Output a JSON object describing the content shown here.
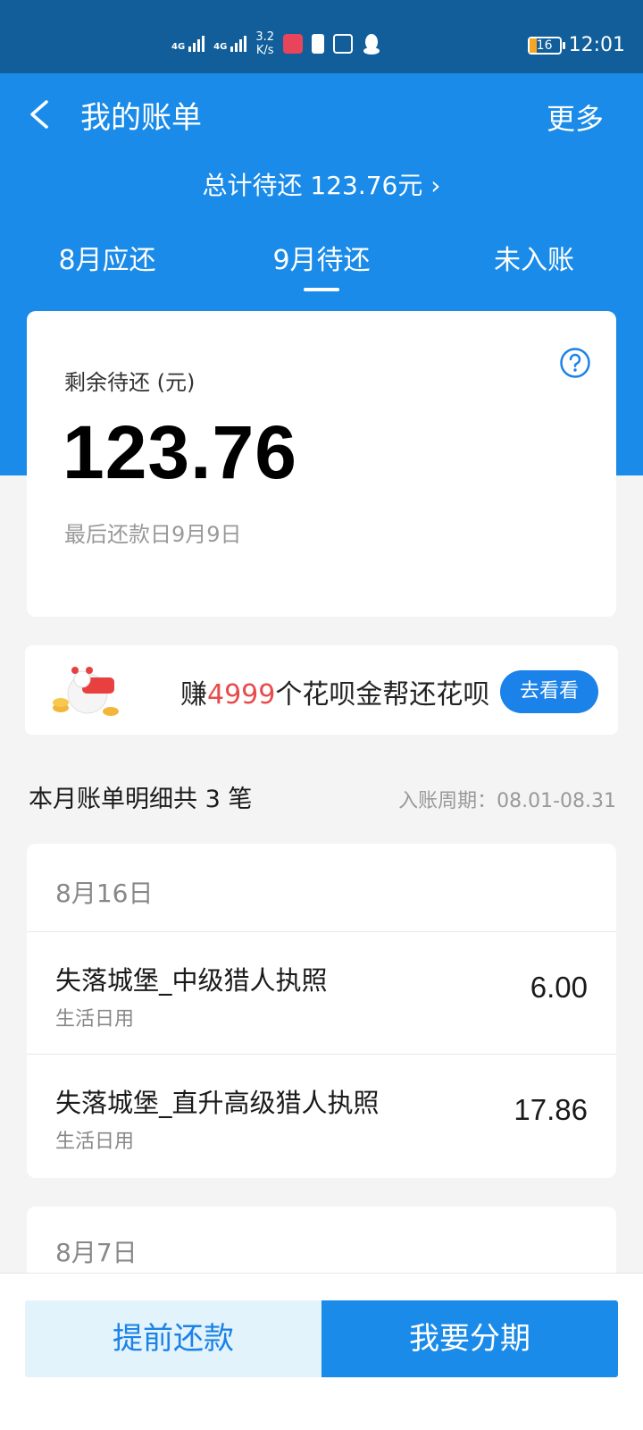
{
  "status_bar": {
    "signal1_label": "4G",
    "signal2_label": "4G",
    "net_speed_value": "3.2",
    "net_speed_unit": "K/s",
    "battery_level": "16",
    "time": "12:01"
  },
  "header": {
    "title": "我的账单",
    "more_label": "更多",
    "total_text": "总计待还 123.76元 ›",
    "back_icon": "chevron-left-icon"
  },
  "tabs": [
    {
      "label": "8月应还",
      "active": false
    },
    {
      "label": "9月待还",
      "active": true
    },
    {
      "label": "未入账",
      "active": false
    }
  ],
  "balance": {
    "label": "剩余待还 (元)",
    "amount": "123.76",
    "due_date": "最后还款日9月9日",
    "help_icon": "question-circle-icon"
  },
  "promo": {
    "prefix": "赚",
    "highlight": "4999",
    "suffix": "个花呗金帮还花呗",
    "button_label": "去看看",
    "highlight_color": "#e84b4b"
  },
  "details": {
    "heading": "本月账单明细共 3 笔",
    "period": "入账周期：08.01-08.31"
  },
  "bill_groups": [
    {
      "date": "8月16日",
      "items": [
        {
          "name": "失落城堡_中级猎人执照",
          "category": "生活日用",
          "amount": "6.00"
        },
        {
          "name": "失落城堡_直升高级猎人执照",
          "category": "生活日用",
          "amount": "17.86"
        }
      ]
    },
    {
      "date": "8月7日",
      "items": []
    }
  ],
  "bottom": {
    "early_label": "提前还款",
    "installment_label": "我要分期"
  },
  "colors": {
    "status_bar": "#115e9a",
    "header": "#1a8be8",
    "accent": "#1a82e8",
    "early_bg": "#e3f3fc"
  }
}
